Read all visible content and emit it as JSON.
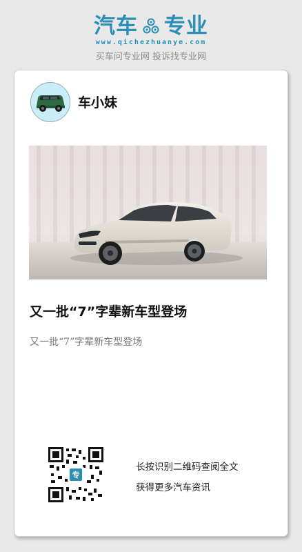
{
  "brand": {
    "title_left": "汽车",
    "title_right": "专业",
    "url": "www.qichezhuanye.com",
    "slogan": "买车问专业网 投诉找专业网",
    "color": "#2a8fb7"
  },
  "card": {
    "author": "车小妹",
    "headline": "又一批“7”字辈新车型登场",
    "summary": "又一批“7”字辈新车型登场",
    "cta_line1": "长按识别二维码查阅全文",
    "cta_line2": "获得更多汽车资讯"
  },
  "icons": {
    "brand_gear": "gear-icon",
    "avatar": "green-car-avatar",
    "qr": "qr-code"
  }
}
